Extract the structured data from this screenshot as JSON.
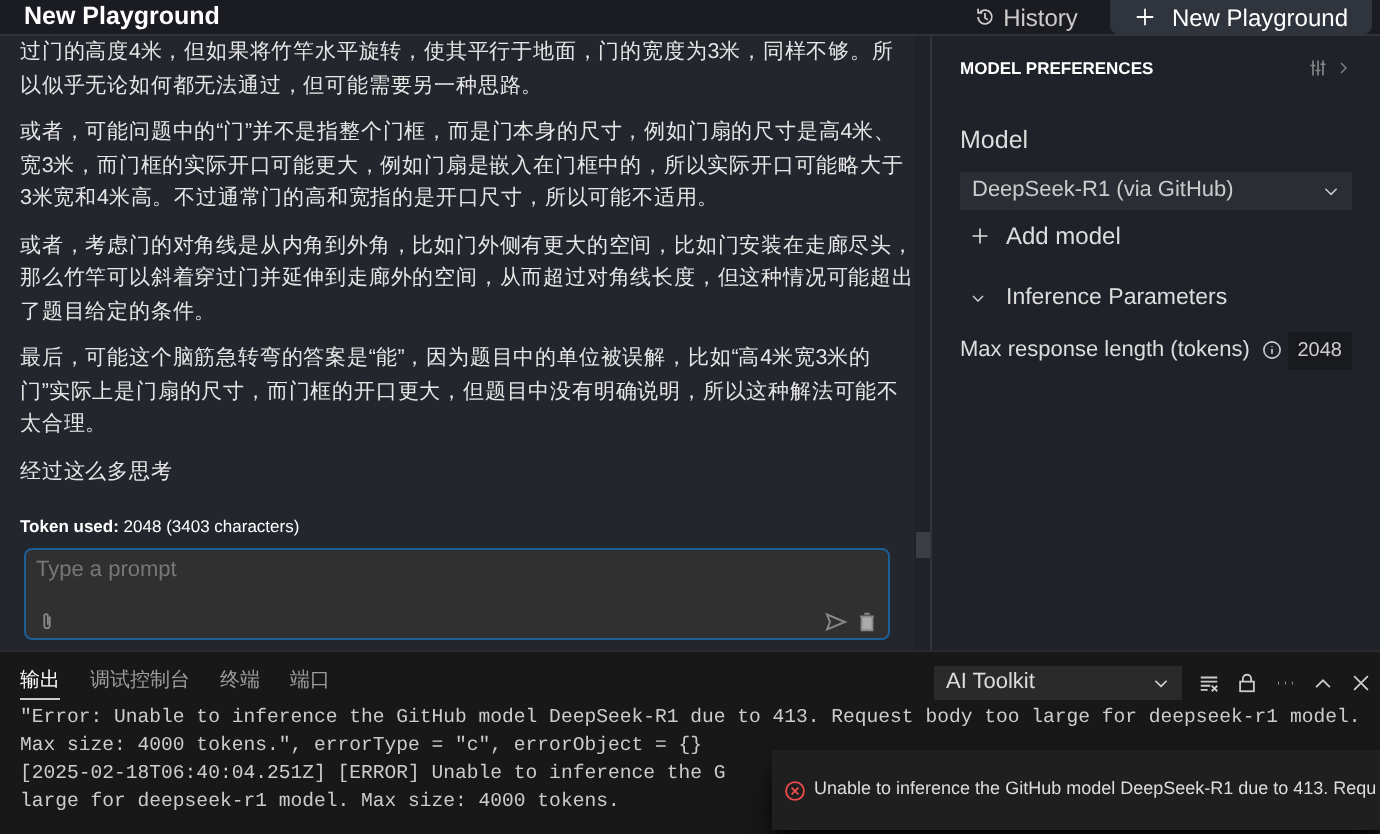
{
  "header": {
    "title": "New Playground",
    "history_button": "History",
    "new_button": "New Playground"
  },
  "chat": {
    "paragraphs": [
      "过门的高度4米，但如果将竹竿水平旋转，使其平行于地面，门的宽度为3米，同样不够。所以似乎无论如何都无法通过，但可能需要另一种思路。",
      "或者，可能问题中的“门”并不是指整个门框，而是门本身的尺寸，例如门扇的尺寸是高4米、宽3米，而门框的实际开口可能更大，例如门扇是嵌入在门框中的，所以实际开口可能略大于3米宽和4米高。不过通常门的高和宽指的是开口尺寸，所以可能不适用。",
      "或者，考虑门的对角线是从内角到外角，比如门外侧有更大的空间，比如门安装在走廊尽头，那么竹竿可以斜着穿过门并延伸到走廊外的空间，从而超过对角线长度，但这种情况可能超出了题目给定的条件。",
      "最后，可能这个脑筋急转弯的答案是“能”，因为题目中的单位被误解，比如“高4米宽3米的门”实际上是门扇的尺寸，而门框的开口更大，但题目中没有明确说明，所以这种解法可能不太合理。",
      "经过这么多思考"
    ],
    "token_usage": "**Token used:** 2048 (3403 characters)",
    "prompt": {
      "placeholder": "Type a prompt"
    }
  },
  "preferences": {
    "title": "MODEL PREFERENCES",
    "model_label": "Model",
    "model_value": "DeepSeek-R1 (via GitHub)",
    "add_model": "Add model",
    "section": {
      "label": "Inference Parameters",
      "expanded": true
    },
    "params": [
      {
        "label": "Max response length (tokens)",
        "value": "2048"
      }
    ]
  },
  "panel": {
    "tabs": [
      {
        "label": "输出",
        "selected": true
      },
      {
        "label": "调试控制台",
        "selected": false
      },
      {
        "label": "终端",
        "selected": false
      },
      {
        "label": "端口",
        "selected": false
      }
    ],
    "output_source": "AI Toolkit",
    "log_lines": [
      "\"Error: Unable to inference the GitHub model DeepSeek-R1 due to 413. Request body too large for deepseek-r1 model.",
      "Max size: 4000 tokens.\", errorType = \"c\", errorObject = {}",
      "[2025-02-18T06:40:04.251Z] [ERROR] Unable to inference the G",
      "large for deepseek-r1 model. Max size: 4000 tokens."
    ]
  },
  "notification": {
    "message": "Unable to inference the GitHub model DeepSeek-R1 due to 413. Requ"
  }
}
